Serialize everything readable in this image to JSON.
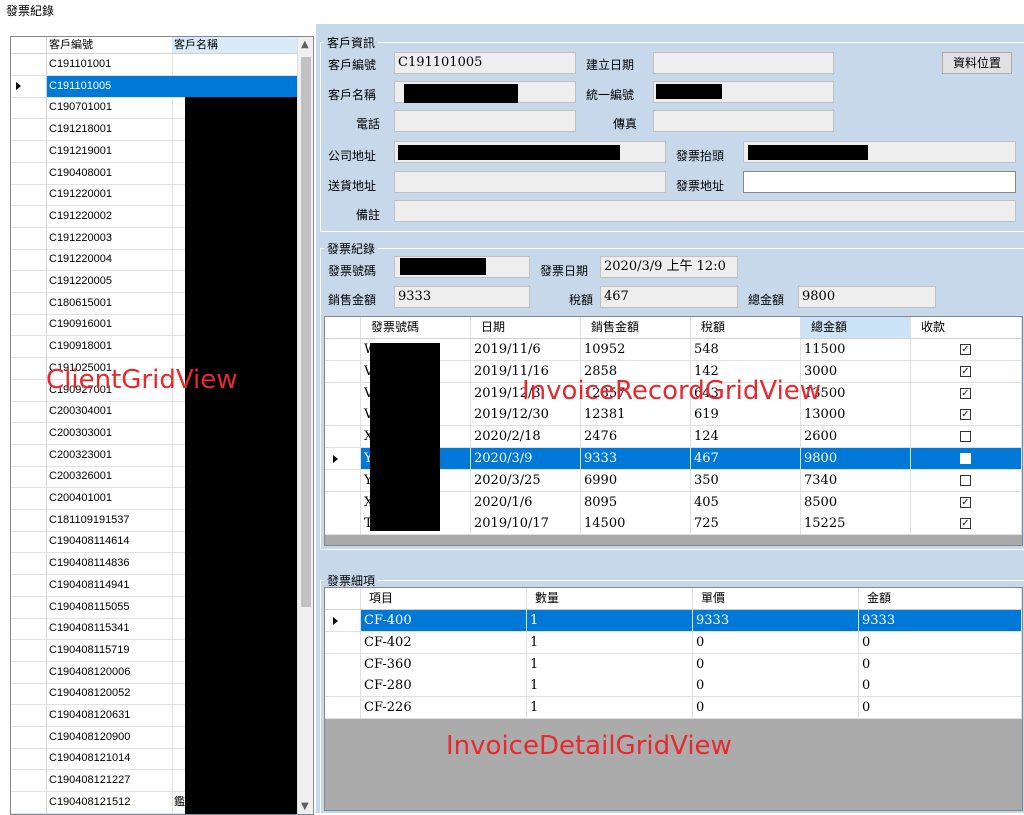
{
  "window_title": "發票紀錄",
  "client_grid": {
    "columns": [
      "客戶編號",
      "客戶名稱"
    ],
    "rows": [
      "C191101001",
      "C191101005",
      "C190701001",
      "C191218001",
      "C191219001",
      "C190408001",
      "C191220001",
      "C191220002",
      "C191220003",
      "C191220004",
      "C191220005",
      "C180615001",
      "C190916001",
      "C190918001",
      "C191025001",
      "C190927001",
      "C200304001",
      "C200303001",
      "C200323001",
      "C200326001",
      "C200401001",
      "C181109191537",
      "C190408114614",
      "C190408114836",
      "C190408114941",
      "C190408115055",
      "C190408115341",
      "C190408115719",
      "C190408120006",
      "C190408120052",
      "C190408120631",
      "C190408120900",
      "C190408121014",
      "C190408121227",
      "C190408121512"
    ],
    "selected_index": 1,
    "last_row_name": "鑑格華業股份有限公司"
  },
  "client_info": {
    "group_label": "客戶資訊",
    "client_no_label": "客戶編號",
    "client_no": "C191101005",
    "created_label": "建立日期",
    "created": "",
    "location_button": "資料位置",
    "client_name_label": "客戶名稱",
    "tax_id_label": "統一編號",
    "phone_label": "電話",
    "fax_label": "傳真",
    "company_address_label": "公司地址",
    "invoice_title_label": "發票抬頭",
    "delivery_address_label": "送貨地址",
    "invoice_address_label": "發票地址",
    "remark_label": "備註"
  },
  "invoice_record": {
    "group_label": "發票紀錄",
    "invoice_no_label": "發票號碼",
    "invoice_date_label": "發票日期",
    "invoice_date": "2020/3/9 上午 12:0",
    "sales_label": "銷售金額",
    "sales": "9333",
    "tax_label": "稅額",
    "tax": "467",
    "total_label": "總金額",
    "total": "9800",
    "columns": [
      "發票號碼",
      "日期",
      "銷售金額",
      "稅額",
      "總金額",
      "收款"
    ],
    "rows": [
      {
        "no": "W",
        "date": "2019/11/6",
        "sales": "10952",
        "tax": "548",
        "total": "11500",
        "paid": true
      },
      {
        "no": "V",
        "date": "2019/11/16",
        "sales": "2858",
        "tax": "142",
        "total": "3000",
        "paid": true
      },
      {
        "no": "V",
        "date": "2019/12/3",
        "sales": "12857",
        "tax": "643",
        "total": "13500",
        "paid": true
      },
      {
        "no": "V",
        "date": "2019/12/30",
        "sales": "12381",
        "tax": "619",
        "total": "13000",
        "paid": true
      },
      {
        "no": "X",
        "date": "2020/2/18",
        "sales": "2476",
        "tax": "124",
        "total": "2600",
        "paid": false
      },
      {
        "no": "Y",
        "date": "2020/3/9",
        "sales": "9333",
        "tax": "467",
        "total": "9800",
        "paid": false
      },
      {
        "no": "Y",
        "date": "2020/3/25",
        "sales": "6990",
        "tax": "350",
        "total": "7340",
        "paid": false
      },
      {
        "no": "X",
        "date": "2020/1/6",
        "sales": "8095",
        "tax": "405",
        "total": "8500",
        "paid": true
      },
      {
        "no": "T",
        "date": "2019/10/17",
        "sales": "14500",
        "tax": "725",
        "total": "15225",
        "paid": true
      }
    ],
    "selected_index": 5
  },
  "invoice_detail": {
    "group_label": "發票細項",
    "columns": [
      "項目",
      "數量",
      "單價",
      "金額"
    ],
    "rows": [
      {
        "item": "CF-400",
        "qty": "1",
        "price": "9333",
        "amount": "9333"
      },
      {
        "item": "CF-402",
        "qty": "1",
        "price": "0",
        "amount": "0"
      },
      {
        "item": "CF-360",
        "qty": "1",
        "price": "0",
        "amount": "0"
      },
      {
        "item": "CF-280",
        "qty": "1",
        "price": "0",
        "amount": "0"
      },
      {
        "item": "CF-226",
        "qty": "1",
        "price": "0",
        "amount": "0"
      }
    ],
    "selected_index": 0
  },
  "annotations": {
    "client_grid": "ClientGridView",
    "invoice_record_grid": "InvoiceRecordGridView",
    "invoice_detail_grid": "InvoiceDetailGridView"
  }
}
